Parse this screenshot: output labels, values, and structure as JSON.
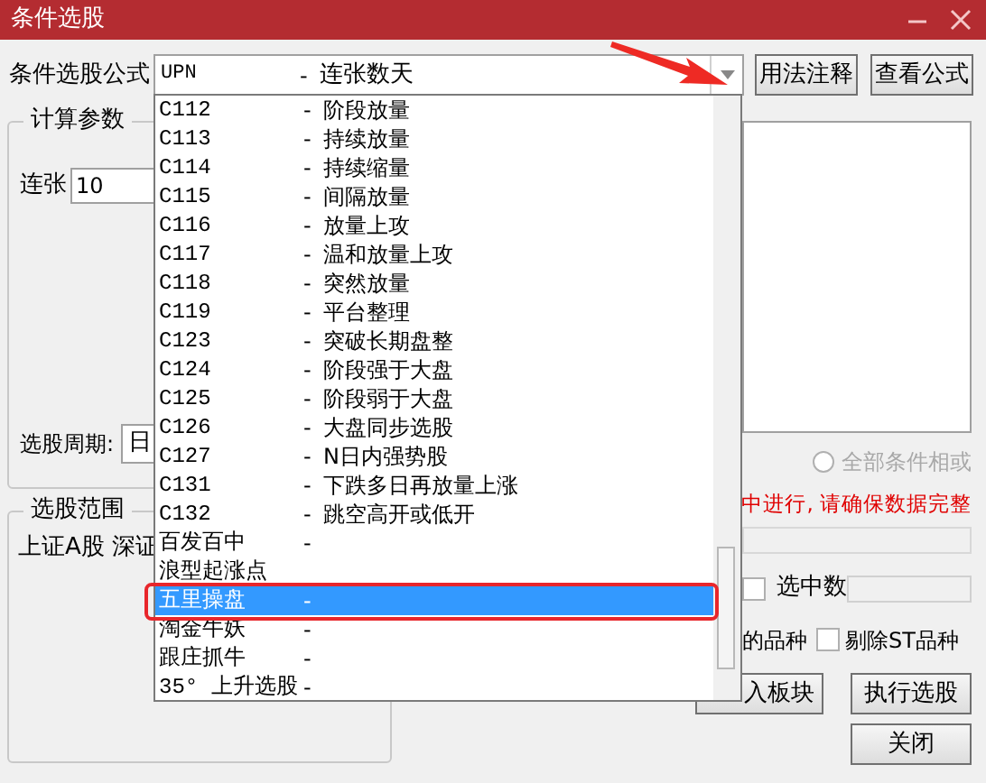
{
  "window": {
    "title": "条件选股"
  },
  "formula": {
    "label": "条件选股公式",
    "code": "UPN",
    "sep": "-",
    "name": "连张数天"
  },
  "top_buttons": [
    "用法注释",
    "查看公式"
  ],
  "params": {
    "title": "计算参数",
    "field_label": "连张",
    "field_value": "10",
    "period_label": "选股周期:",
    "period_value": "日"
  },
  "scope": {
    "title": "选股范围",
    "text": "上证A股 深证"
  },
  "radio": {
    "label": "全部条件相或",
    "selected": false,
    "disabled": true
  },
  "warning": "中进行, 请确保数据完整",
  "count_checkbox": {
    "checked": false
  },
  "count_label": "选中数",
  "variety_text": "的品种",
  "exclude_st": {
    "label": "剔除ST品种",
    "checked": false
  },
  "bottom_buttons": [
    "入板块",
    "执行选股",
    "关闭"
  ],
  "dropdown": {
    "items": [
      {
        "code": "C112",
        "sep": "-",
        "name": "阶段放量",
        "selected": false
      },
      {
        "code": "C113",
        "sep": "-",
        "name": "持续放量",
        "selected": false
      },
      {
        "code": "C114",
        "sep": "-",
        "name": "持续缩量",
        "selected": false
      },
      {
        "code": "C115",
        "sep": "-",
        "name": "间隔放量",
        "selected": false
      },
      {
        "code": "C116",
        "sep": "-",
        "name": "放量上攻",
        "selected": false
      },
      {
        "code": "C117",
        "sep": "-",
        "name": "温和放量上攻",
        "selected": false
      },
      {
        "code": "C118",
        "sep": "-",
        "name": "突然放量",
        "selected": false
      },
      {
        "code": "C119",
        "sep": "-",
        "name": "平台整理",
        "selected": false
      },
      {
        "code": "C123",
        "sep": "-",
        "name": "突破长期盘整",
        "selected": false
      },
      {
        "code": "C124",
        "sep": "-",
        "name": "阶段强于大盘",
        "selected": false
      },
      {
        "code": "C125",
        "sep": "-",
        "name": "阶段弱于大盘",
        "selected": false
      },
      {
        "code": "C126",
        "sep": "-",
        "name": "大盘同步选股",
        "selected": false
      },
      {
        "code": "C127",
        "sep": "-",
        "name": "N日内强势股",
        "selected": false
      },
      {
        "code": "C131",
        "sep": "-",
        "name": "下跌多日再放量上涨",
        "selected": false
      },
      {
        "code": "C132",
        "sep": "-",
        "name": "跳空高开或低开",
        "selected": false
      },
      {
        "code": "百发百中",
        "sep": "-",
        "selected": false
      },
      {
        "code": "浪型起涨点",
        "selected": false
      },
      {
        "code": "五里操盘",
        "sep": "-",
        "selected": true
      },
      {
        "code": "淘金牛妖",
        "sep": "-",
        "selected": false
      },
      {
        "code": "跟庄抓牛",
        "sep": "-",
        "selected": false
      },
      {
        "code": "35° 上升选股",
        "sep": "-",
        "selected": false
      }
    ]
  }
}
